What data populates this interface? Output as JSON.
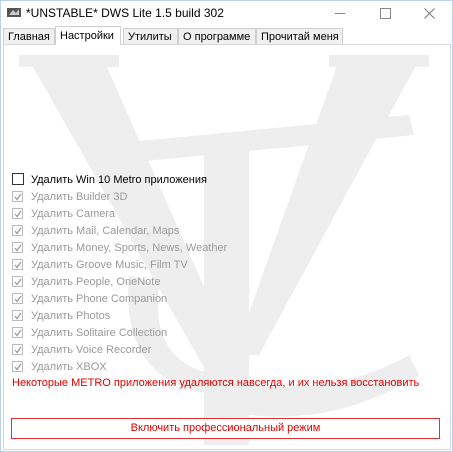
{
  "window": {
    "title": "*UNSTABLE* DWS Lite 1.5 build 302"
  },
  "tabs": [
    {
      "label": "Главная",
      "active": false
    },
    {
      "label": "Настройки",
      "active": true
    },
    {
      "label": "Утилиты",
      "active": false
    },
    {
      "label": "О программе",
      "active": false
    },
    {
      "label": "Прочитай меня",
      "active": false
    }
  ],
  "settings": {
    "master": {
      "label": "Удалить Win 10 Metro приложения",
      "checked": false
    },
    "items": [
      {
        "label": "Удалить Builder 3D",
        "checked": true
      },
      {
        "label": "Удалить Camera",
        "checked": true
      },
      {
        "label": "Удалить Mail, Calendar, Maps",
        "checked": true
      },
      {
        "label": "Удалить Money, Sports, News, Weather",
        "checked": true
      },
      {
        "label": "Удалить Groove Music, Film TV",
        "checked": true
      },
      {
        "label": "Удалить People, OneNote",
        "checked": true
      },
      {
        "label": "Удалить Phone Companion",
        "checked": true
      },
      {
        "label": "Удалить Photos",
        "checked": true
      },
      {
        "label": "Удалить Solitaire Collection",
        "checked": true
      },
      {
        "label": "Удалить Voice Recorder",
        "checked": true
      },
      {
        "label": "Удалить XBOX",
        "checked": true
      }
    ],
    "warning": "Некоторые METRO приложения удаляются навсегда, и их нельзя восстановить",
    "pro_button": "Включить профессиональный режим"
  },
  "colors": {
    "warning": "#e00000",
    "disabled_text": "#9a9a9a",
    "watermark": "#eeeeee"
  }
}
